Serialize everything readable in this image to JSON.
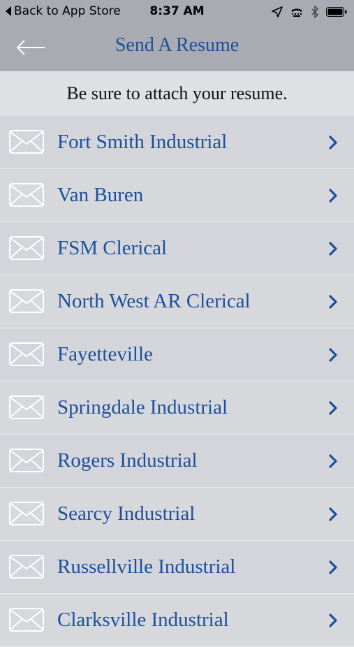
{
  "status_bar": {
    "back_label": "Back to App Store",
    "time": "8:37 AM"
  },
  "nav": {
    "title": "Send A Resume"
  },
  "subtitle": "Be sure to attach your resume.",
  "colors": {
    "accent": "#1c4f9c",
    "bar": "#a8acb2",
    "background": "#d3d5da"
  },
  "list": {
    "items": [
      {
        "label": "Fort Smith Industrial",
        "icon": "envelope-icon"
      },
      {
        "label": "Van Buren",
        "icon": "envelope-icon"
      },
      {
        "label": "FSM Clerical",
        "icon": "envelope-icon"
      },
      {
        "label": "North West AR Clerical",
        "icon": "envelope-icon"
      },
      {
        "label": "Fayetteville",
        "icon": "envelope-icon"
      },
      {
        "label": "Springdale Industrial",
        "icon": "envelope-icon"
      },
      {
        "label": "Rogers Industrial",
        "icon": "envelope-icon"
      },
      {
        "label": "Searcy Industrial",
        "icon": "envelope-icon"
      },
      {
        "label": "Russellville Industrial",
        "icon": "envelope-icon"
      },
      {
        "label": "Clarksville Industrial",
        "icon": "envelope-icon"
      }
    ]
  }
}
